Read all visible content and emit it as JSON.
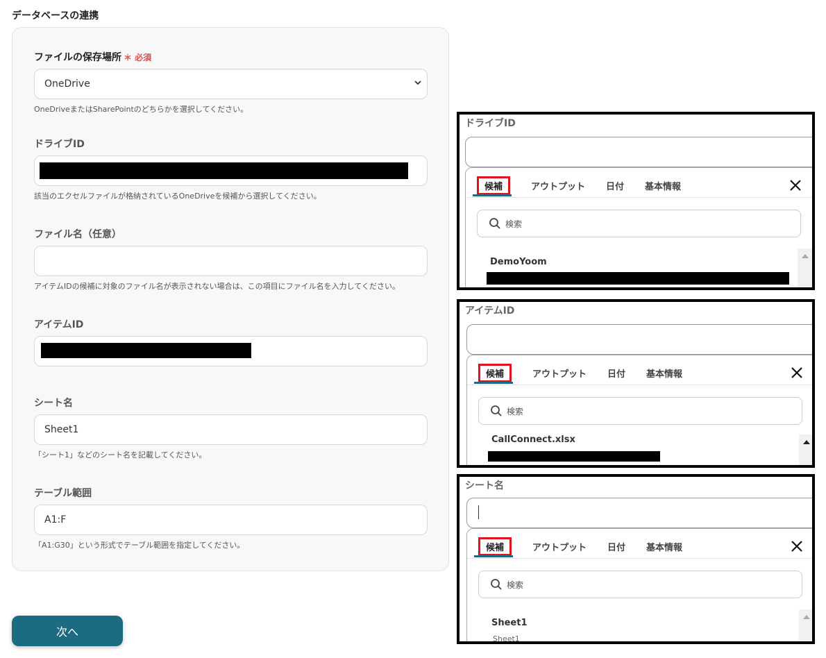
{
  "page": {
    "title": "データベースの連携"
  },
  "form": {
    "storage": {
      "label": "ファイルの保存場所",
      "required_mark": "＊ 必須",
      "value": "OneDrive",
      "hint": "OneDriveまたはSharePointのどちらかを選択してください。"
    },
    "drive_id": {
      "label": "ドライブID",
      "hint": "該当のエクセルファイルが格納されているOneDriveを候補から選択してください。"
    },
    "file_name": {
      "label": "ファイル名（任意）",
      "value": "",
      "hint": "アイテムIDの候補に対象のファイル名が表示されない場合は、この項目にファイル名を入力してください。"
    },
    "item_id": {
      "label": "アイテムID"
    },
    "sheet_name": {
      "label": "シート名",
      "value": "Sheet1",
      "hint": "「シート1」などのシート名を記載してください。"
    },
    "table_range": {
      "label": "テーブル範囲",
      "value": "A1:F",
      "hint": "「A1:G30」という形式でテーブル範囲を指定してください。"
    },
    "next_label": "次へ"
  },
  "tabs": [
    "候補",
    "アウトプット",
    "日付",
    "基本情報"
  ],
  "search_placeholder": "検索",
  "panels": [
    {
      "label": "ドライブID",
      "option": "DemoYoom",
      "sub": ""
    },
    {
      "label": "アイテムID",
      "option": "CallConnect.xlsx",
      "sub": ""
    },
    {
      "label": "シート名",
      "option": "Sheet1",
      "sub": "Sheet1"
    }
  ],
  "colors": {
    "primary": "#1c6b80",
    "required": "#e24a4a",
    "highlight": "#e0141e"
  }
}
